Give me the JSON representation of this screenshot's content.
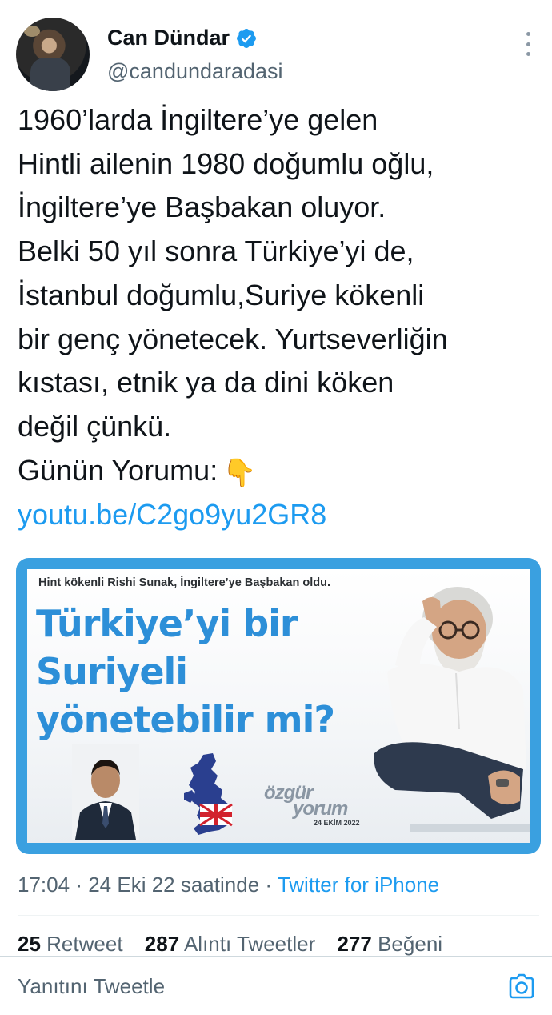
{
  "author": {
    "name": "Can Dündar",
    "handle": "@candundaradasi",
    "verified_icon": "verified-badge-icon",
    "avatar_icon": "avatar"
  },
  "tweet": {
    "text": "1960’larda İngiltere’ye gelen\nHintli ailenin 1980 doğumlu oğlu,\nİngiltere’ye Başbakan oluyor.\nBelki 50 yıl sonra Türkiye’yi de,\nİstanbul doğumlu,Suriye kökenli\nbir genç yönetecek. Yurtseverliğin\nkıstası, etnik ya da dini köken\ndeğil çünkü.\nGünün Yorumu:",
    "emoji": "👇",
    "link": "youtu.be/C2go9yu2GR8"
  },
  "card": {
    "subtitle": "Hint kökenli Rishi Sunak,  İngiltere’ye Başbakan oldu.",
    "title": "Türkiye’yi bir\nSuriyeli\nyönetebilir mi?",
    "logo_word1": "özgür",
    "logo_word2": "yorum",
    "logo_date": "24 EKİM 2022"
  },
  "meta": {
    "time": "17:04",
    "date": "24 Eki 22 saatinde",
    "separator": "·",
    "source": "Twitter for iPhone"
  },
  "stats": {
    "retweets_count": "25",
    "retweets_label": "Retweet",
    "quotes_count": "287",
    "quotes_label": "Alıntı Tweetler",
    "likes_count": "277",
    "likes_label": "Beğeni"
  },
  "reply": {
    "placeholder": "Yanıtını Tweetle",
    "camera_icon": "camera-icon"
  },
  "colors": {
    "accent": "#1d9bf0",
    "text": "#0f1419",
    "muted": "#536471",
    "card_border": "#3aa0e0",
    "card_title": "#2d8fd8"
  }
}
